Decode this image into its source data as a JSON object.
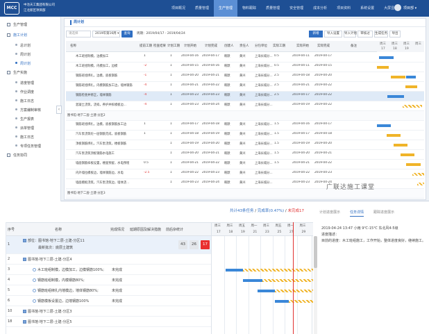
{
  "app": {
    "logo_text": "MCC",
    "org_line1": "中冶天工集团有限公司",
    "org_line2": "江北新区项目部",
    "nav": [
      "项目概况",
      "质量管理",
      "生产管理",
      "物料跟踪",
      "质量管理",
      "安全管理",
      "成本分析",
      "项目资料",
      "系统设置",
      "大屏显示"
    ],
    "active_nav": 2,
    "user": "项目部 ▾"
  },
  "sidebar": {
    "items": [
      {
        "label": "生产管理",
        "icon": "home-icon",
        "level": 1
      },
      {
        "label": "施工计划",
        "icon": "calendar-icon",
        "level": 1,
        "active": true
      },
      {
        "label": "总计划",
        "level": 2
      },
      {
        "label": "周计划",
        "level": 2
      },
      {
        "label": "周计划",
        "level": 2,
        "active": true
      },
      {
        "label": "生产实施",
        "icon": "tool-icon",
        "level": 1
      },
      {
        "label": "进度管理",
        "level": 2
      },
      {
        "label": "作业调度",
        "level": 2
      },
      {
        "label": "施工日志",
        "level": 2
      },
      {
        "label": "方案编制审核",
        "level": 2
      },
      {
        "label": "生产报表",
        "level": 2
      },
      {
        "label": "派单管理",
        "level": 2
      },
      {
        "label": "施工日志",
        "level": 2
      },
      {
        "label": "专项任务管理",
        "level": 2
      },
      {
        "label": "任务协同",
        "icon": "link-icon",
        "level": 1
      }
    ],
    "collapse_glyph": "‹"
  },
  "panel": {
    "title": "周计划",
    "filter_placeholder": "请选择",
    "week_value": "2019年第16周 ▾",
    "query_label": "查询",
    "cycle_label": "周期：",
    "cycle_value": "2019/04/17 - 2019/04/24",
    "toolbar": [
      "新增",
      "导入设置",
      "导入计划",
      "审核过",
      "生成任务",
      "导出"
    ],
    "columns": [
      "名称",
      "",
      "提前工期",
      "检查结果",
      "计划工期",
      "计划开始",
      "计划完成",
      "创建人",
      "责任人",
      "分包单位",
      "实际工期",
      "实际开始",
      "实际完成",
      "备注"
    ],
    "gantt_months": [
      "周三",
      "周三",
      "周三",
      "周三"
    ],
    "gantt_days": [
      "17",
      "18",
      "19"
    ],
    "rows": [
      {
        "name": "木工班组制模，边模加工",
        "ahead": "1",
        "work": "1",
        "start": "2019-04-16",
        "finish": "2019-04-17",
        "creator": "韩默",
        "owner": "黄兴",
        "sub": "上海长城分...",
        "actwork": "0.5",
        "astart": "2019-04-11",
        "afinish": "2019-04-17",
        "bars": [
          [
            0.05,
            0.3,
            "blue"
          ]
        ]
      },
      {
        "name": "木工班组制模，内模加工，边模",
        "ahead": "-2",
        "work": "1",
        "start": "2019-04-15",
        "finish": "2019-04-16",
        "creator": "韩默",
        "owner": "黄兴",
        "sub": "上海长城分...",
        "actwork": "0.5",
        "astart": "2019-04-11",
        "afinish": "2019-04-15",
        "bars": [
          [
            0.0,
            0.25,
            "yel"
          ]
        ]
      },
      {
        "name": "钢筋班组绑扎，边模，底板钢筋",
        "ahead": "-1",
        "work": "1",
        "start": "2019-04-20",
        "finish": "2019-04-21",
        "creator": "韩默",
        "owner": "黄兴",
        "sub": "上海长城分...",
        "actwork": "2.5",
        "astart": "2019-04-18",
        "afinish": "2019-04-20",
        "bars": [
          [
            0.3,
            0.3,
            "yel"
          ],
          [
            0.62,
            0.2,
            "blue"
          ]
        ]
      },
      {
        "name": "钢筋班组绑扎，内模钢筋加工边，墙体钢筋",
        "ahead": "-4",
        "work": "1",
        "start": "2019-04-21",
        "finish": "2019-04-22",
        "creator": "韩默",
        "owner": "黄兴",
        "sub": "上海长城分...",
        "actwork": "2.5",
        "astart": "2019-04-21",
        "afinish": "2019-04-22",
        "bars": [
          [
            0.6,
            0.25,
            "yel"
          ]
        ]
      },
      {
        "name": "钢筋检查并修正，墙体钢筋",
        "ahead": "-4",
        "work": "1",
        "start": "2019-04-23",
        "finish": "2019-04-23",
        "creator": "韩默",
        "owner": "黄兴",
        "sub": "上海长城分...",
        "actwork": "2.5",
        "astart": "2019-04-17",
        "afinish": "2019-04-22",
        "bars": [
          [
            0.22,
            0.35,
            "blue"
          ]
        ],
        "hl": true
      },
      {
        "name": "混凝土浇筑，浇捣，养护并拆模板边...",
        "ahead": "-4",
        "work": "1",
        "start": "2019-04-23",
        "finish": "2019-04-24",
        "creator": "韩默",
        "owner": "黄兴",
        "sub": "上海长城分...",
        "actwork": "",
        "astart": "2019-04-19",
        "afinish": "2019-04-22",
        "bars": [
          [
            0.55,
            0.4,
            "hatch"
          ]
        ]
      },
      {
        "group": "图书馆-地下二层-土建-分区2"
      },
      {
        "name": "钢筋班组绑扎，边模，底板钢筋加工边",
        "ahead": "1",
        "work": "1",
        "start": "2019-04-17",
        "finish": "2019-04-18",
        "creator": "韩默",
        "owner": "黄兴",
        "sub": "上海长城分...",
        "actwork": "1.5",
        "astart": "2019-04-16",
        "afinish": "2019-04-17",
        "bars": [
          [
            0.0,
            0.3,
            "blue"
          ]
        ]
      },
      {
        "name": "汽车泵浇筑砼一层钢筋完成，底板钢筋",
        "ahead": "1",
        "work": "1",
        "start": "2019-04-18",
        "finish": "2019-04-19",
        "creator": "韩默",
        "owner": "黄兴",
        "sub": "上海长城分...",
        "actwork": "1.5",
        "astart": "2019-04-17",
        "afinish": "2019-04-18",
        "bars": [
          [
            0.2,
            0.3,
            "yel"
          ]
        ]
      },
      {
        "name": "顶板钢筋绑扎，汽车泵浇筑，楼板钢筋",
        "ahead": "",
        "work": "1",
        "start": "2019-04-19",
        "finish": "2019-04-20",
        "creator": "韩默",
        "owner": "黄兴",
        "sub": "上海长城分...",
        "actwork": "1.5",
        "astart": "2019-04-19",
        "afinish": "2019-04-20",
        "bars": [
          [
            0.35,
            0.3,
            "yel"
          ]
        ]
      },
      {
        "name": "汽车泵浇筑顶板钢筋水电施工",
        "ahead": "",
        "work": "1",
        "start": "2019-04-20",
        "finish": "2019-04-21",
        "creator": "韩默",
        "owner": "黄兴",
        "sub": "上海长城分...",
        "actwork": "1.5",
        "astart": "2019-04-20",
        "afinish": "2019-04-21",
        "bars": [
          [
            0.5,
            0.3,
            "yel"
          ]
        ]
      },
      {
        "name": "墙面钢筋样板设置，楼面预留，水电预埋",
        "ahead": "0.5",
        "work": "1",
        "start": "2019-04-21",
        "finish": "2019-04-22",
        "creator": "韩默",
        "owner": "黄兴",
        "sub": "上海长城分...",
        "actwork": "1.5",
        "astart": "2019-04-21",
        "afinish": "2019-04-22",
        "bars": [
          [
            0.62,
            0.3,
            "yel"
          ]
        ]
      },
      {
        "name": "内外墙拉模板边，墙体钢筋边，水电",
        "ahead": "-2.5",
        "work": "1",
        "start": "2019-04-22",
        "finish": "2019-04-23",
        "creator": "韩默",
        "owner": "黄兴",
        "sub": "上海长城分...",
        "actwork": "",
        "astart": "2019-04-22",
        "afinish": "2019-04-23",
        "bars": [
          [
            0.75,
            0.25,
            "hatch"
          ]
        ]
      },
      {
        "name": "墙面模板浇筑，汽车泵浇筑边，墙体浇...",
        "ahead": "",
        "work": "1",
        "start": "2019-04-23",
        "finish": "2019-04-24",
        "creator": "韩默",
        "owner": "黄兴",
        "sub": "上海长城分...",
        "actwork": "",
        "astart": "2019-04-23",
        "afinish": "2019-04-24",
        "bars": [
          [
            0.85,
            0.15,
            "hatch"
          ]
        ]
      },
      {
        "group": "图书馆-地下二层-土建-分区3"
      }
    ]
  },
  "watermark": "广联达施工课堂",
  "bottom": {
    "stats": {
      "total": "共计43条任务",
      "done": "完成率(0.47%)",
      "overdue": "未完成17"
    },
    "tabs": [
      "计划进度展示",
      "任务详情",
      "跟踪进度展示"
    ],
    "active_tab": 1,
    "columns": [
      "序号",
      "名称",
      "完成情况",
      "延期原因及解决措施",
      "前后杂统计"
    ],
    "gantt_weeks": [
      "周三",
      "周三",
      "周五",
      "周一",
      "周三",
      "周五",
      "周一",
      "周三"
    ],
    "gantt_days": [
      "17",
      "18",
      "19",
      "21",
      "23",
      "25",
      "27",
      "29"
    ],
    "rows": [
      {
        "num": "1",
        "name": "部位：图书馆-地下二层-土建-分区11",
        "name2": "最新批次：底层土建筑",
        "chips": [
          "43",
          "26",
          "17"
        ],
        "hl": true
      },
      {
        "num": "2",
        "name": "图书馆-地下二层-土建-分区4",
        "folder": true
      },
      {
        "num": "3",
        "name": "木工班组制模，边模加工，边模钢筋100%;",
        "status": "未完成",
        "check": true,
        "bar": [
          0.14,
          0.31,
          "blue"
        ],
        "hatch": [
          0.31,
          1.0
        ]
      },
      {
        "num": "4",
        "name": "钢筋班组制模，内模钢筋80%;",
        "status": "未完成",
        "check": true,
        "bar": [
          0.31,
          0.5,
          "blue"
        ],
        "hatch": [
          0.5,
          1.0
        ]
      },
      {
        "num": "5",
        "name": "钢筋班组绑扎内墙模边，墙体钢筋80%;",
        "status": "未完成",
        "check": true,
        "bar": [
          0.45,
          0.62,
          "blue"
        ],
        "hatch": [
          0.62,
          1.0
        ]
      },
      {
        "num": "6",
        "name": "钢筋模板设置边，边墙钢筋100%",
        "status": "未完成",
        "check": true,
        "bar": [
          0.62,
          0.76,
          "blue"
        ],
        "hatch": [
          0.76,
          1.0
        ]
      },
      {
        "num": "10",
        "name": "图书馆-地下二层-土建-分区3",
        "folder": true
      },
      {
        "num": "18",
        "name": "图书馆-地下二层-土建-分区5",
        "folder": true
      }
    ],
    "weather_line": "2019-04-24 13:47  小雨 9℃-15℃ 东北风4-5级",
    "note_title": "进度描述：",
    "note_body": "目前的进度：木工班组施工，工作开始，整体进度良好，继续施工。"
  },
  "colors": {
    "nav_bg": "#1e4f94",
    "accent": "#2f6ec2",
    "bar_blue": "#3a87d8",
    "bar_yellow": "#f0b429",
    "overdue_red": "#e92f2f"
  }
}
